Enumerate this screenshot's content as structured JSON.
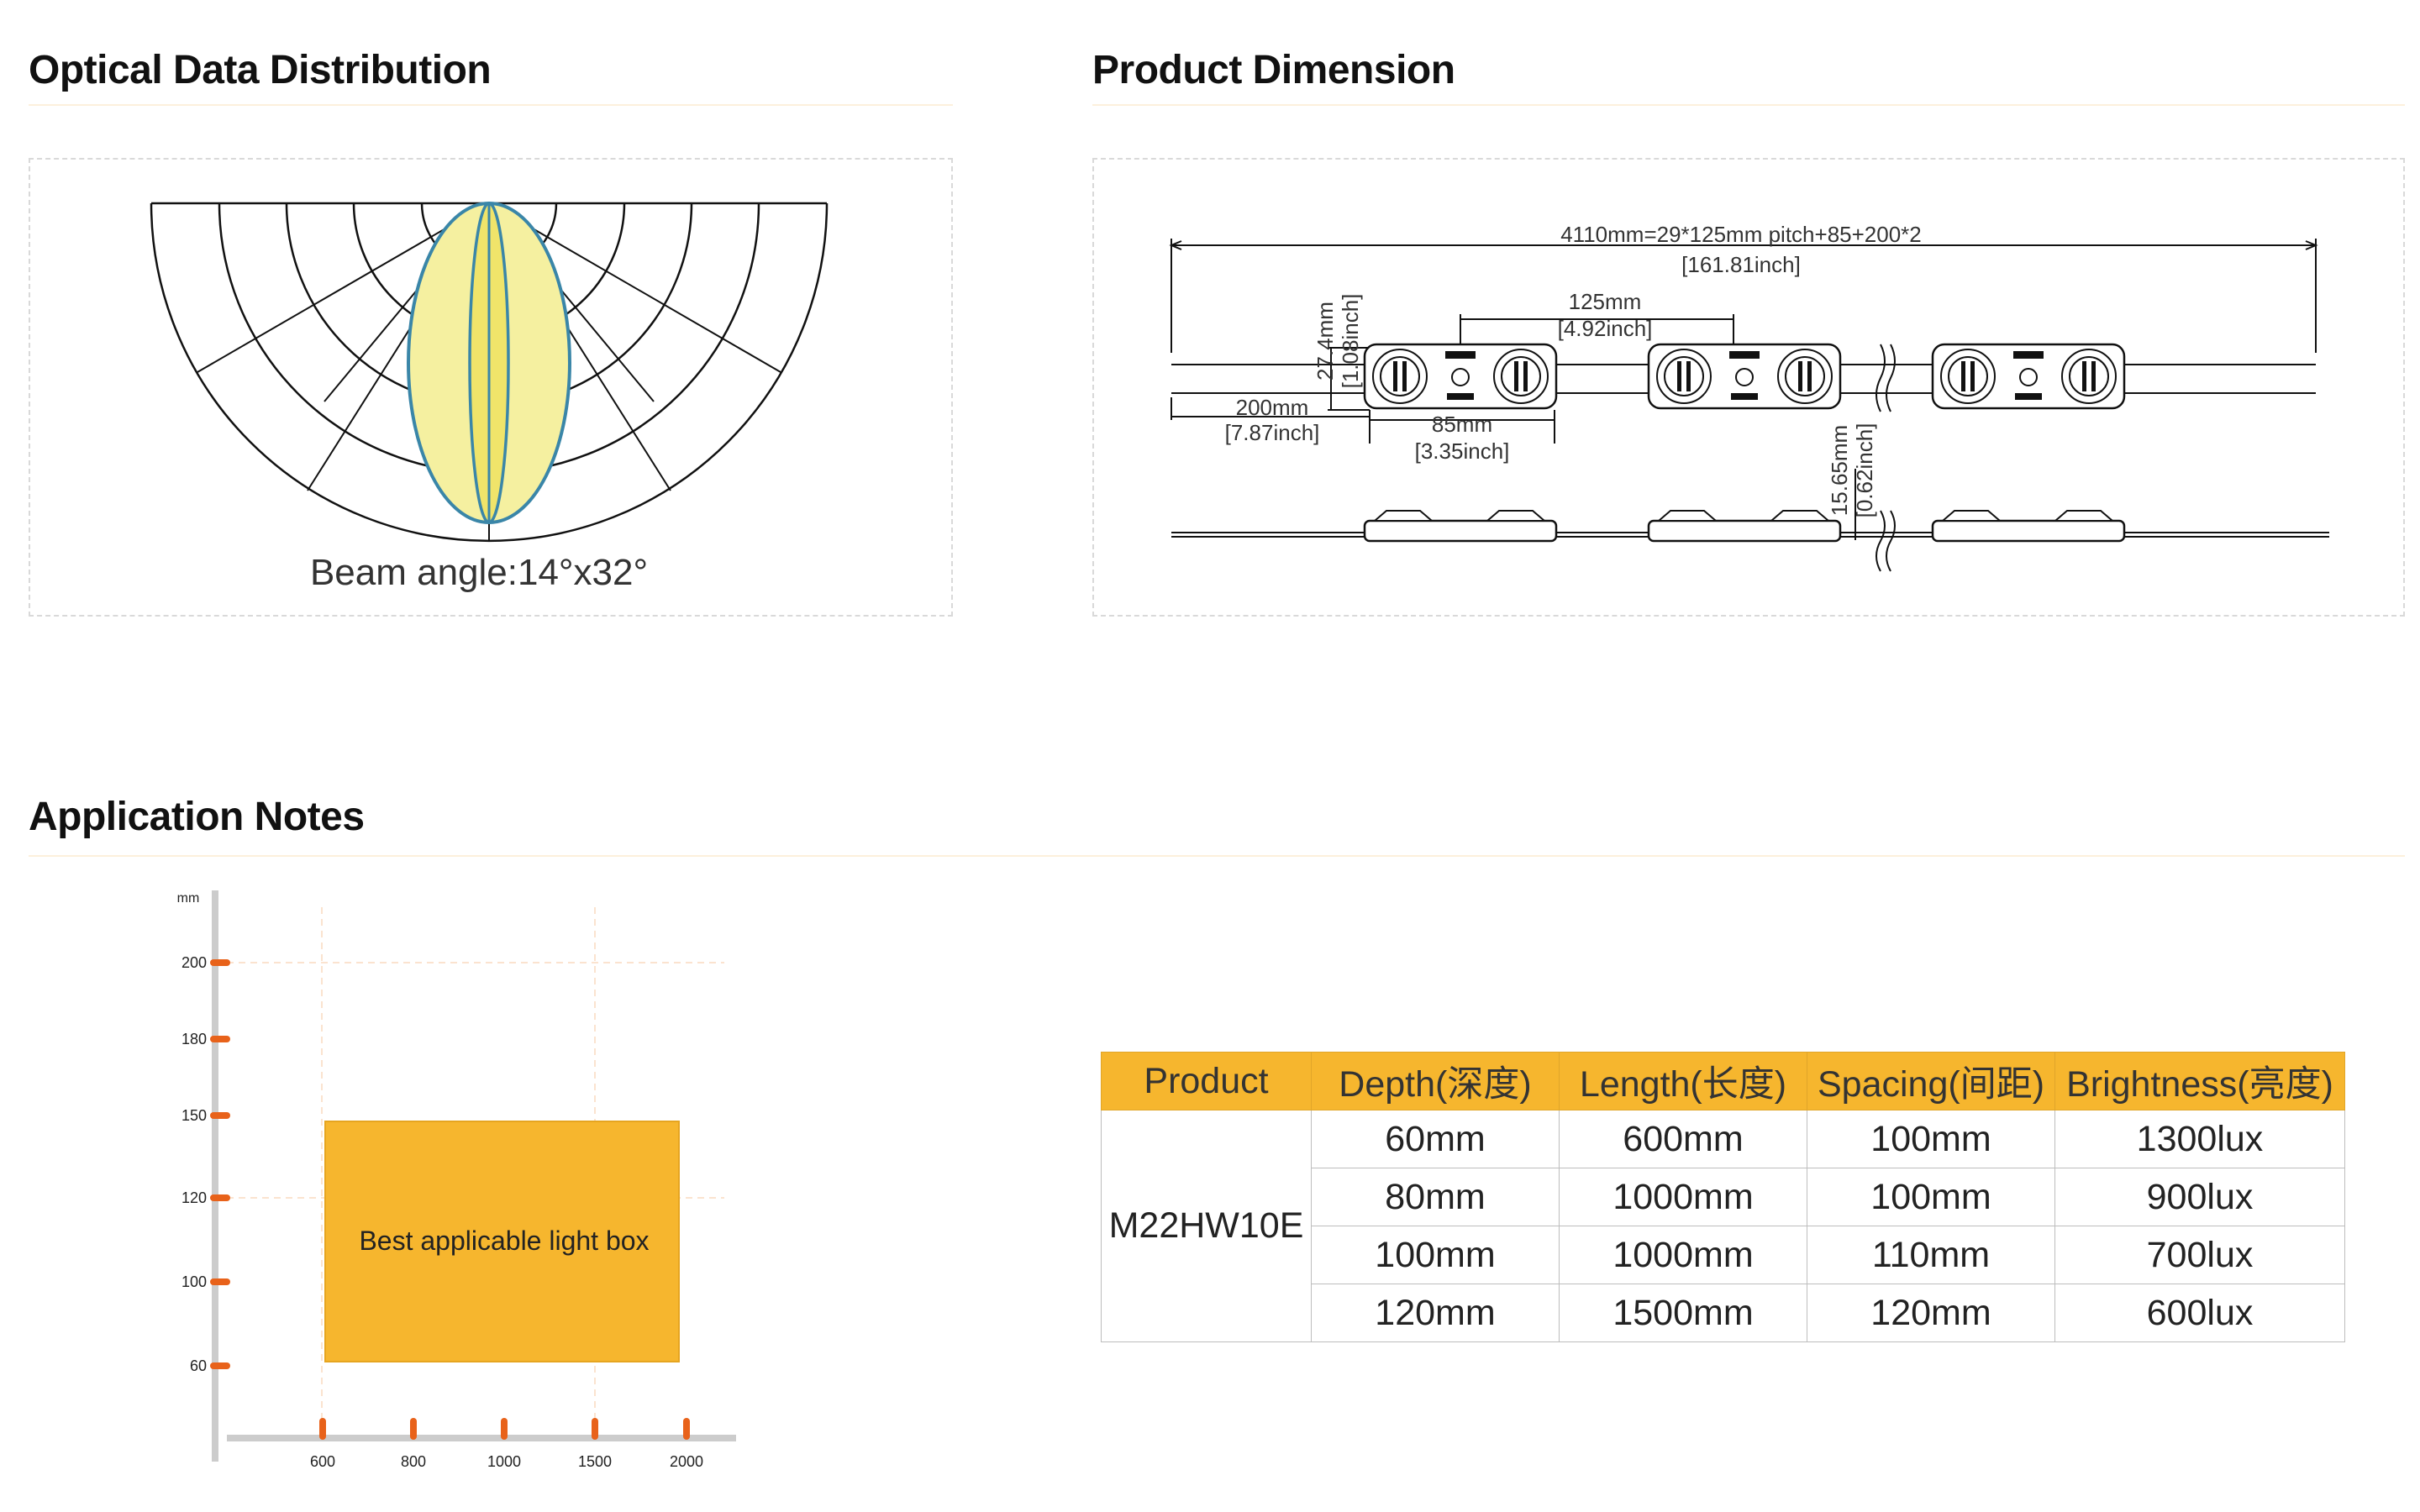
{
  "sections": {
    "optical_title": "Optical Data Distribution",
    "dimension_title": "Product Dimension",
    "application_title": "Application Notes"
  },
  "optical": {
    "beam_label": "Beam angle:14°x32°",
    "colors": {
      "beam_fill": "#f5f0a0",
      "beam_stroke": "#3a86a8"
    }
  },
  "dimension": {
    "overall_mm": "4110mm=29*125mm pitch+85+200*2",
    "overall_inch": "[161.81inch]",
    "height_mm": "27.4mm",
    "height_inch": "[1.08inch]",
    "pitch_mm": "125mm",
    "pitch_inch": "[4.92inch]",
    "lead_mm": "200mm",
    "lead_inch": "[7.87inch]",
    "module_mm": "85mm",
    "module_inch": "[3.35inch]",
    "thickness_mm": "15.65mm",
    "thickness_inch": "[0.62inch]"
  },
  "application": {
    "unit_label": "mm",
    "y_ticks": [
      "200",
      "180",
      "150",
      "120",
      "100",
      "60"
    ],
    "x_ticks": [
      "600",
      "800",
      "1000",
      "1500",
      "2000"
    ],
    "box_label": "Best applicable light box",
    "colors": {
      "box": "#f6b62e",
      "tick": "#e8621a",
      "axis": "#cccccc",
      "grid": "#fbe3cf"
    }
  },
  "spec_table": {
    "headers": [
      "Product",
      "Depth(深度)",
      "Length(长度)",
      "Spacing(间距)",
      "Brightness(亮度)"
    ],
    "product": "M22HW10E",
    "rows": [
      [
        "60mm",
        "600mm",
        "100mm",
        "1300lux"
      ],
      [
        "80mm",
        "1000mm",
        "100mm",
        "900lux"
      ],
      [
        "100mm",
        "1000mm",
        "110mm",
        "700lux"
      ],
      [
        "120mm",
        "1500mm",
        "120mm",
        "600lux"
      ]
    ],
    "colors": {
      "header_bg": "#f6b62e"
    }
  }
}
